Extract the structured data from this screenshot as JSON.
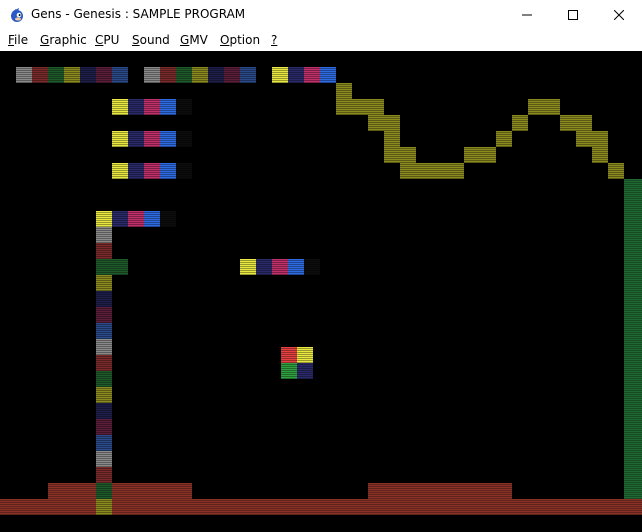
{
  "window": {
    "title": "Gens - Genesis : SAMPLE PROGRAM",
    "controls": [
      "minimize",
      "maximize",
      "close"
    ]
  },
  "menu": {
    "items": [
      {
        "label": "File",
        "accel": "F",
        "rest": "ile"
      },
      {
        "label": "Graphic",
        "accel": "G",
        "rest": "raphic"
      },
      {
        "label": "CPU",
        "accel": "C",
        "rest": "PU"
      },
      {
        "label": "Sound",
        "accel": "S",
        "rest": "ound"
      },
      {
        "label": "GMV",
        "accel": "G",
        "rest": "MV"
      },
      {
        "label": "Option",
        "accel": "O",
        "rest": "ption"
      },
      {
        "label": "?",
        "accel": "?",
        "rest": ""
      }
    ]
  },
  "colors": {
    "titlebar_bg": "#ffffff",
    "screen_bg": "#000000",
    "yellow": "#e8e840",
    "navy": "#2a2a6a",
    "magenta": "#c0306a",
    "blue": "#2e6ae0",
    "dim_tail": "#0c0c0c",
    "gray": "#8a8a8a",
    "dark_red": "#7a2a2a",
    "dark_green": "#1e5a2a",
    "olive": "#8a8a1e",
    "dark_navy": "#1e1e4a",
    "maroon": "#5a1e3a",
    "steel_blue": "#2a4a8a",
    "brick": "#8a3228",
    "green_wall": "#1e6a32",
    "red": "#e84040",
    "green": "#30a040"
  }
}
